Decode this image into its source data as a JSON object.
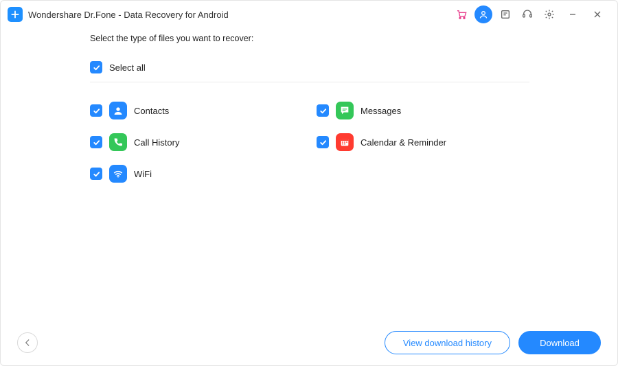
{
  "titlebar": {
    "title": "Wondershare Dr.Fone - Data Recovery for Android"
  },
  "content": {
    "prompt": "Select the type of files you want to recover:",
    "select_all_label": "Select all"
  },
  "items": {
    "contacts": {
      "label": "Contacts",
      "checked": true
    },
    "messages": {
      "label": "Messages",
      "checked": true
    },
    "call_history": {
      "label": "Call History",
      "checked": true
    },
    "calendar": {
      "label": "Calendar & Reminder",
      "checked": true
    },
    "wifi": {
      "label": "WiFi",
      "checked": true
    }
  },
  "footer": {
    "view_history": "View download history",
    "download": "Download"
  },
  "colors": {
    "primary": "#2489ff",
    "green": "#34c759",
    "red": "#ff3b30",
    "cart": "#e83e8c"
  }
}
